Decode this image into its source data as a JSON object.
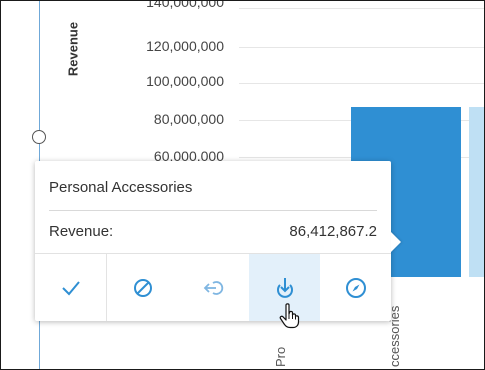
{
  "chart": {
    "y_axis_label": "Revenue",
    "y_ticks": [
      "140,000,000",
      "120,000,000",
      "100,000,000",
      "80,000,000",
      "60,000,000"
    ],
    "x_labels": [
      "Pro",
      "ccessories"
    ],
    "colors": {
      "bar_primary": "#2f8fd3",
      "bar_secondary": "#bfe0f4",
      "axis_rail": "#6fa8d8"
    }
  },
  "tooltip": {
    "title": "Personal Accessories",
    "measure_label": "Revenue:",
    "measure_value": "86,412,867.2",
    "actions": [
      {
        "icon": "checkmark-icon",
        "state": "default"
      },
      {
        "icon": "exclude-icon",
        "state": "default"
      },
      {
        "icon": "drill-up-icon",
        "state": "default"
      },
      {
        "icon": "drill-down-icon",
        "state": "hover"
      },
      {
        "icon": "explore-compass-icon",
        "state": "default"
      }
    ],
    "accent_color": "#2f8fd3"
  }
}
